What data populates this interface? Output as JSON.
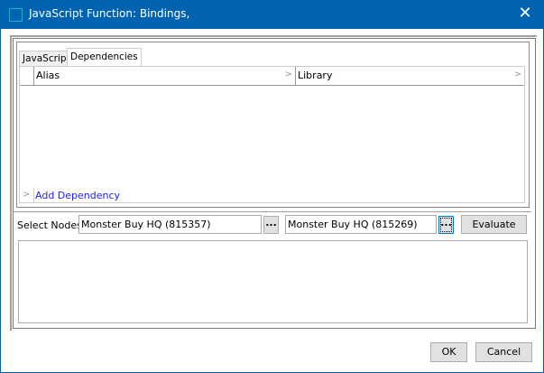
{
  "window": {
    "title": "JavaScript Function: Bindings,",
    "close": "✕"
  },
  "tabs": [
    {
      "label": "JavaScript"
    },
    {
      "label": "Dependencies"
    }
  ],
  "grid": {
    "columns": [
      "Alias",
      "Library"
    ],
    "add_label": "Add Dependency"
  },
  "nodes": {
    "label": "Select Nodes",
    "node1": "Monster Buy HQ (815357)",
    "node2": "Monster Buy HQ (815269)",
    "browse": "...",
    "evaluate": "Evaluate"
  },
  "output": "",
  "footer": {
    "ok": "OK",
    "cancel": "Cancel"
  }
}
